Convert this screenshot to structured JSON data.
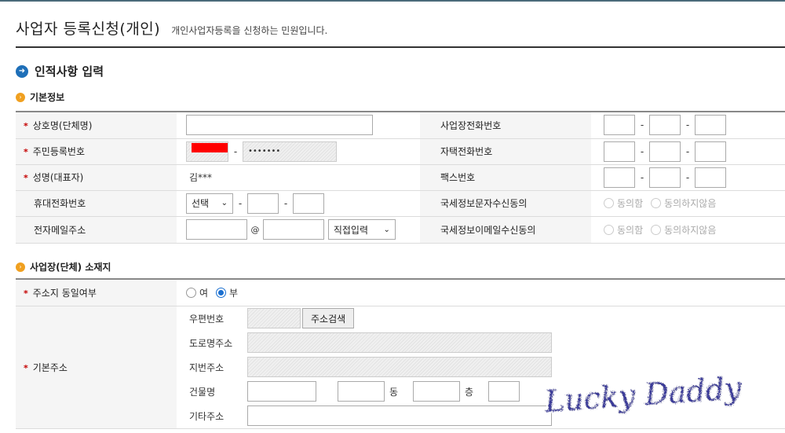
{
  "header": {
    "title": "사업자 등록신청(개인)",
    "description": "개인사업자등록을 신청하는 민원입니다."
  },
  "section": {
    "title": "인적사항 입력"
  },
  "basic_info": {
    "title": "기본정보",
    "trade_name_label": "상호명(단체명)",
    "rrn_label": "주민등록번호",
    "rrn_masked": "•••••••",
    "name_label": "성명(대표자)",
    "name_value": "김***",
    "mobile_label": "휴대전화번호",
    "mobile_select": "선택",
    "email_label": "전자메일주소",
    "email_at": "@",
    "email_select": "직접입력",
    "biz_phone_label": "사업장전화번호",
    "home_phone_label": "자택전화번호",
    "fax_label": "팩스번호",
    "sms_consent_label": "국세정보문자수신동의",
    "email_consent_label": "국세정보이메일수신동의",
    "consent_yes": "동의함",
    "consent_no": "동의하지않음",
    "dash": "-"
  },
  "location": {
    "title": "사업장(단체) 소재지",
    "same_address_label": "주소지 동일여부",
    "yes": "여",
    "no": "부",
    "selected": "부",
    "base_address_label": "기본주소",
    "postal_label": "우편번호",
    "search_button": "주소검색",
    "road_label": "도로명주소",
    "lot_label": "지번주소",
    "building_label": "건물명",
    "dong_label": "동",
    "floor_label": "층",
    "etc_label": "기타주소"
  },
  "watermark_text": "Lucky Daddy",
  "colors": {
    "required": "#c40000",
    "section_icon": "#1e6fb8",
    "sub_icon": "#f0a020",
    "mask": "#ff0000"
  }
}
